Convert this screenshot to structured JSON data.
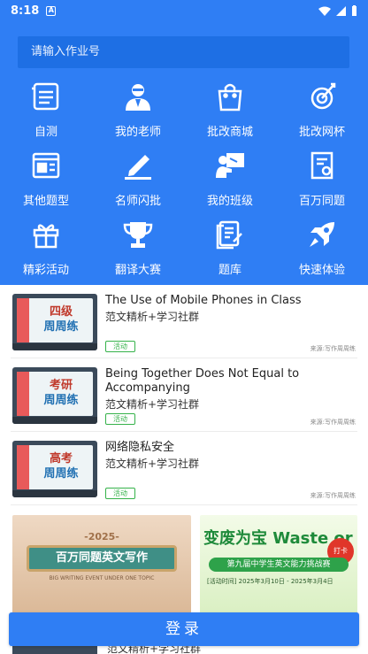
{
  "status": {
    "time": "8:18",
    "a_badge": "A"
  },
  "search": {
    "placeholder": "请输入作业号"
  },
  "grid": [
    {
      "label": "自测",
      "icon": "notebook-icon"
    },
    {
      "label": "我的老师",
      "icon": "teacher-icon"
    },
    {
      "label": "批改商城",
      "icon": "shopping-bag-icon"
    },
    {
      "label": "批改网杯",
      "icon": "target-rocket-icon"
    },
    {
      "label": "其他题型",
      "icon": "browser-page-icon"
    },
    {
      "label": "名师闪批",
      "icon": "pen-write-icon"
    },
    {
      "label": "我的班级",
      "icon": "classroom-icon"
    },
    {
      "label": "百万同题",
      "icon": "certificate-icon"
    },
    {
      "label": "精彩活动",
      "icon": "gift-icon"
    },
    {
      "label": "翻译大赛",
      "icon": "trophy-icon"
    },
    {
      "label": "题库",
      "icon": "question-bank-icon"
    },
    {
      "label": "快速体验",
      "icon": "rocket-icon"
    }
  ],
  "articles": [
    {
      "thumb_line1": "四级",
      "thumb_line2": "周周练",
      "title": "The Use of Mobile Phones in Class",
      "subtitle": "范文精析+学习社群",
      "tag": "活动",
      "source": "来源:写作周周练"
    },
    {
      "thumb_line1": "考研",
      "thumb_line2": "周周练",
      "title": "Being Together Does Not Equal to Accompanying",
      "subtitle": "范文精析+学习社群",
      "tag": "活动",
      "source": "来源:写作周周练"
    },
    {
      "thumb_line1": "高考",
      "thumb_line2": "周周练",
      "title": "网络隐私安全",
      "subtitle": "范文精析+学习社群",
      "tag": "活动",
      "source": "来源:写作周周练"
    }
  ],
  "banners": {
    "left": {
      "year": "-2025-",
      "title": "百万同题英文写作",
      "english": "BIG WRITING EVENT UNDER ONE TOPIC"
    },
    "right": {
      "title": "变废为宝 Waste or",
      "subtitle": "第九届中学生英文能力挑战赛",
      "dates": "[活动时间] 2025年3月10日 - 2025年3月4日",
      "badge": "打卡"
    }
  },
  "peek": {
    "subtitle": "范文精析+学习社群"
  },
  "login": {
    "label": "登录"
  }
}
